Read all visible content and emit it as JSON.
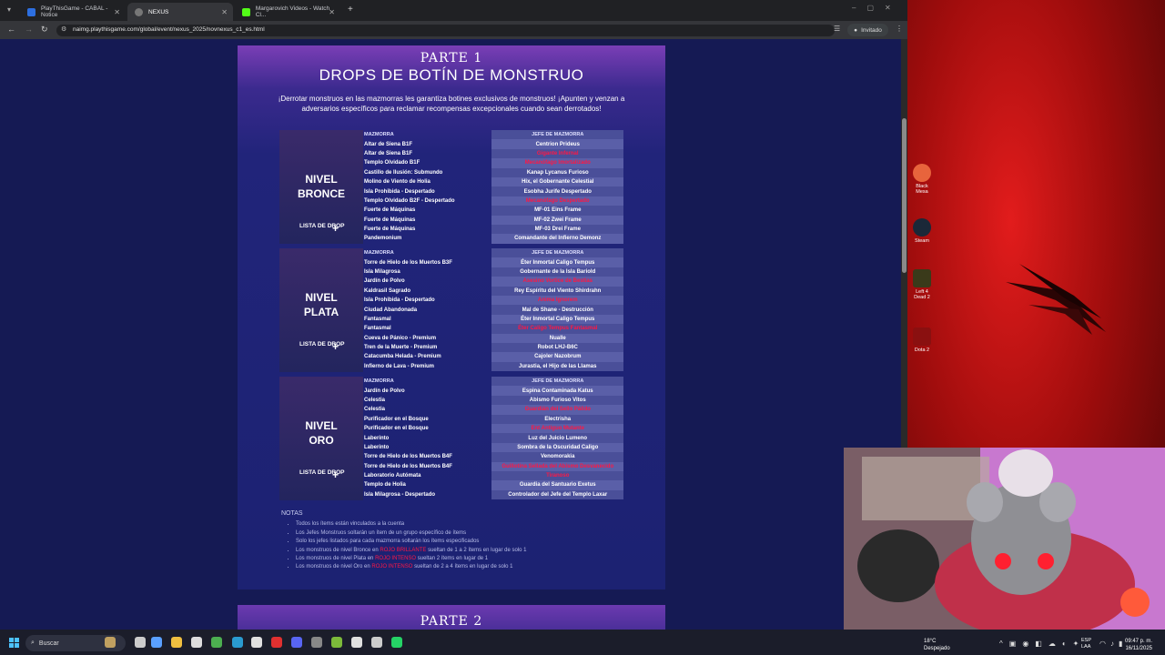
{
  "browser": {
    "tabs": [
      {
        "label": "PlayThisGame - CABAL - Notice",
        "color": "#2d6fe0"
      },
      {
        "label": "NEXUS",
        "color": "#888888"
      },
      {
        "label": "Margarovich Videos - Watch Cl...",
        "color": "#53fc18"
      }
    ],
    "url": "naimg.playthisgame.com/global/event/nexus_2025/novnexus_c1_es.html",
    "profile": "Invitado"
  },
  "page": {
    "part1": "PARTE 1",
    "title": "DROPS DE BOTÍN DE MONSTRUO",
    "intro": "¡Derrotar monstruos en las mazmorras les garantiza botines exclusivos de monstruos! ¡Apunten y venzan a adversarios específicos para reclamar recompensas excepcionales cuando sean derrotados!",
    "col_dungeon": "MAZMORRA",
    "col_boss": "JEFE DE MAZMORRA",
    "drop_list": "LISTA DE DROP",
    "tiers": [
      {
        "name_a": "NIVEL",
        "name_b": "BRONCE",
        "rows": [
          {
            "d": "Altar de Siena B1F",
            "b": "Centrion Prideus",
            "red": false
          },
          {
            "d": "Altar de Siena B1F",
            "b": "Gigante Infernal",
            "red": true
          },
          {
            "d": "Templo Olvidado B1F",
            "b": "Mecanófago Imortalizado",
            "red": true
          },
          {
            "d": "Castillo de Ilusión: Submundo",
            "b": "Kanap Lycanus Furioso",
            "red": false
          },
          {
            "d": "Molino de Viento de Holia",
            "b": "Hix, el Gobernante Celestial",
            "red": false
          },
          {
            "d": "Isla Prohibida - Despertado",
            "b": "Esobha Jurife Despertado",
            "red": false
          },
          {
            "d": "Templo Olvidado B2F - Despertado",
            "b": "Mecanófago Despertado",
            "red": true
          },
          {
            "d": "Fuerte de Máquinas",
            "b": "MF-01 Eins Frame",
            "red": false
          },
          {
            "d": "Fuerte de Máquinas",
            "b": "MF-02 Zwei Frame",
            "red": false
          },
          {
            "d": "Fuerte de Máquinas",
            "b": "MF-03 Drei Frame",
            "red": false
          },
          {
            "d": "Pandemonium",
            "b": "Comandante del Infierno Demonz",
            "red": false
          }
        ]
      },
      {
        "name_a": "NIVEL",
        "name_b": "PLATA",
        "rows": [
          {
            "d": "Torre de Hielo de los Muertos B3F",
            "b": "Éter Inmortal Caligo Tempus",
            "red": false
          },
          {
            "d": "Isla Milagrosa",
            "b": "Gobernante de la Isla Bariold",
            "red": false
          },
          {
            "d": "Jardín de Polvo",
            "b": "Asesino Vortice de Bestias",
            "red": true
          },
          {
            "d": "Kaldrasil Sagrado",
            "b": "Rey Espíritu del Viento Shirdrahn",
            "red": false
          },
          {
            "d": "Isla Prohibida - Despertado",
            "b": "Anima Ignorem",
            "red": true
          },
          {
            "d": "Ciudad Abandonada",
            "b": "Mal de Shane - Destrucción",
            "red": false
          },
          {
            "d": "Fantasmal",
            "b": "Éter Inmortal Caligo Tempus",
            "red": false
          },
          {
            "d": "Fantasmal",
            "b": "Éter Caligo Tempus Fantasmal",
            "red": true
          },
          {
            "d": "Cueva de Pánico - Premium",
            "b": "Nualle",
            "red": false
          },
          {
            "d": "Tren de la Muerte - Premium",
            "b": "Robot LHJ-B6C",
            "red": false
          },
          {
            "d": "Catacumba Helada - Premium",
            "b": "Cajoler Nazobrum",
            "red": false
          },
          {
            "d": "Infierno de Lava - Premium",
            "b": "Jurastia, el Hijo de las Llamas",
            "red": false
          }
        ]
      },
      {
        "name_a": "NIVEL",
        "name_b": "ORO",
        "rows": [
          {
            "d": "Jardín de Polvo",
            "b": "Espina Contaminada Katus",
            "red": false
          },
          {
            "d": "Celestia",
            "b": "Abismo Furioso Vitos",
            "red": false
          },
          {
            "d": "Celestia",
            "b": "Guardián del Sello Pálido",
            "red": true
          },
          {
            "d": "Purificador en el Bosque",
            "b": "Electrisha",
            "red": false
          },
          {
            "d": "Purificador en el Bosque",
            "b": "Ent Antiguo Mutante",
            "red": true
          },
          {
            "d": "Laberinto",
            "b": "Luz del Juicio Lumeno",
            "red": false
          },
          {
            "d": "Laberinto",
            "b": "Sombra de la Oscuridad Caligo",
            "red": false
          },
          {
            "d": "Torre de Hielo de los Muertos B4F",
            "b": "Venomorakia",
            "red": false
          },
          {
            "d": "Torre de Hielo de los Muertos B4F",
            "b": "Guillotina Sellada del Abismo Desvanecido",
            "red": true
          },
          {
            "d": "Laboratorio Autómata",
            "b": "Tiranoso",
            "red": true
          },
          {
            "d": "Templo de Holia",
            "b": "Guardia del Santuario Exetus",
            "red": false
          },
          {
            "d": "Isla Milagrosa - Despertado",
            "b": "Controlador del Jefe del Templo Laxar",
            "red": false
          }
        ]
      }
    ],
    "notes_title": "NOTAS",
    "notes": [
      {
        "pre": "Todos los ítems están vinculados a la cuenta",
        "red": "",
        "post": ""
      },
      {
        "pre": "Los Jefes Monstruos soltarán un ítem de un grupo específico de ítems",
        "red": "",
        "post": ""
      },
      {
        "pre": "Solo los jefes listados para cada mazmorra soltarán los ítems especificados",
        "red": "",
        "post": ""
      },
      {
        "pre": "Los monstruos de nivel Bronce en ",
        "red": "ROJO BRILLANTE",
        "post": " sueltan de 1 a 2 ítems en lugar de solo 1"
      },
      {
        "pre": "Los monstruos de nivel Plata en ",
        "red": "ROJO INTENSO",
        "post": " sueltan 2 ítems en lugar de 1"
      },
      {
        "pre": "Los monstruos de nivel Oro en ",
        "red": "ROJO INTENSO",
        "post": " sueltan de 2 a 4 ítems en lugar de solo 1"
      }
    ],
    "part2": "PARTE 2"
  },
  "desktop": {
    "icons": [
      "Black Mesa",
      "Steam",
      "Left 4 Dead 2",
      "Dota 2"
    ]
  },
  "taskbar": {
    "search": "Buscar",
    "weather_temp": "18°C",
    "weather_desc": "Despejado",
    "lang_a": "ESP",
    "lang_b": "LAA",
    "time": "09:47 p. m.",
    "date": "16/11/2025"
  }
}
